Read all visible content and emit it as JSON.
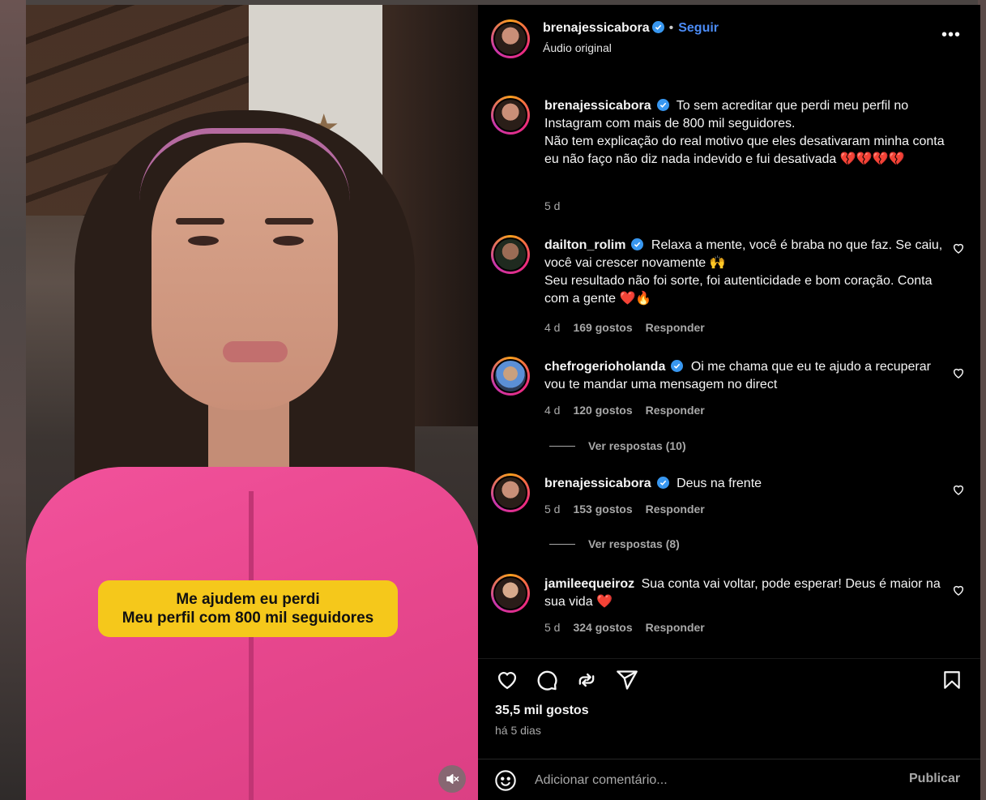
{
  "post": {
    "username": "brenajessicabora",
    "follow_label": "Seguir",
    "audio_label": "Áudio original",
    "more_label": "•••",
    "caption_line1": "Me ajudem eu perdi",
    "caption_line2": "Meu perfil com 800 mil seguidores"
  },
  "comments": [
    {
      "username": "brenajessicabora",
      "verified": true,
      "text": "To sem acreditar que perdi meu perfil no Instagram com mais de 800 mil seguidores.",
      "text2": "Não tem explicação do real motivo que eles desativaram minha conta eu não faço não diz nada indevido e fui desativada 💔💔💔💔",
      "time": "5 d"
    },
    {
      "username": "dailton_rolim",
      "verified": true,
      "text": "Relaxa a mente, você é braba no que faz. Se caiu, você vai crescer novamente 🙌",
      "text2": "Seu resultado não foi sorte, foi autenticidade e bom coração. Conta com a gente ❤️🔥",
      "time": "4 d",
      "likes": "169 gostos",
      "reply": "Responder"
    },
    {
      "username": "chefrogerioholanda",
      "verified": true,
      "text": "Oi me chama que eu te ajudo a recuperar vou te mandar uma mensagem no direct",
      "time": "4 d",
      "likes": "120 gostos",
      "reply": "Responder",
      "view_replies": "Ver respostas (10)"
    },
    {
      "username": "brenajessicabora",
      "verified": true,
      "text": "Deus na frente",
      "time": "5 d",
      "likes": "153 gostos",
      "reply": "Responder",
      "view_replies": "Ver respostas (8)"
    },
    {
      "username": "jamileequeiroz",
      "verified": false,
      "text": "Sua conta vai voltar, pode esperar! Deus é maior na sua vida ❤️",
      "time": "5 d",
      "likes": "324 gostos",
      "reply": "Responder"
    }
  ],
  "footer": {
    "likes": "35,5 mil gostos",
    "posted": "há 5 dias",
    "comment_placeholder": "Adicionar comentário...",
    "publish_label": "Publicar"
  },
  "colors": {
    "accent_blue": "#4b8bf5",
    "verified_blue": "#3897f0",
    "caption_yellow": "#f5c81b",
    "panel_bg": "#000000"
  },
  "icons": [
    "heart-icon",
    "comment-icon",
    "repost-icon",
    "share-icon",
    "bookmark-icon",
    "emoji-icon",
    "mute-icon",
    "verified-badge-icon"
  ]
}
